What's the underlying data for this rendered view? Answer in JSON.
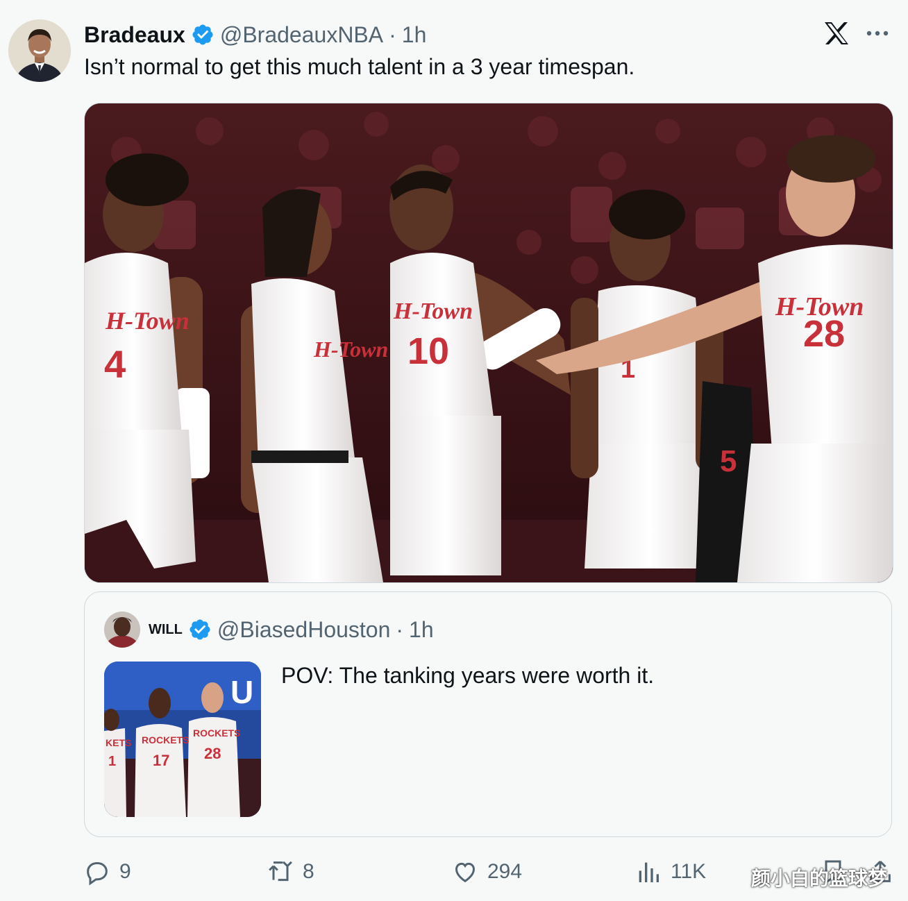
{
  "tweet": {
    "display_name": "Bradeaux",
    "handle": "@BradeauxNBA",
    "separator": "·",
    "time": "1h",
    "text": "Isn’t normal to get this much talent in a 3 year timespan.",
    "photo": {
      "jersey_text": [
        "H-Town",
        "H-Town",
        "H-Town",
        "H-Town"
      ],
      "jersey_numbers": [
        "4",
        "10",
        "1",
        "28",
        "5"
      ]
    }
  },
  "quote": {
    "display_name": "WILL",
    "handle": "@BiasedHouston",
    "separator": "·",
    "time": "1h",
    "text": "POV: The tanking years were worth it.",
    "thumb": {
      "banner_text": "U",
      "jersey_numbers": [
        "1",
        "17",
        "28"
      ],
      "jersey_text": [
        "KETS",
        "ROCKETS",
        "ROCKETS"
      ]
    }
  },
  "actions": {
    "reply_count": "9",
    "retweet_count": "8",
    "like_count": "294",
    "view_count": "11K"
  },
  "watermark": "颜小白的篮球梦",
  "colors": {
    "verified": "#1d9bf0",
    "text_secondary": "#536471",
    "border": "#cfd9de"
  },
  "icons": [
    "verified-icon",
    "x-logo-icon",
    "more-icon",
    "reply-icon",
    "retweet-icon",
    "like-icon",
    "views-icon",
    "bookmark-icon",
    "share-icon"
  ]
}
